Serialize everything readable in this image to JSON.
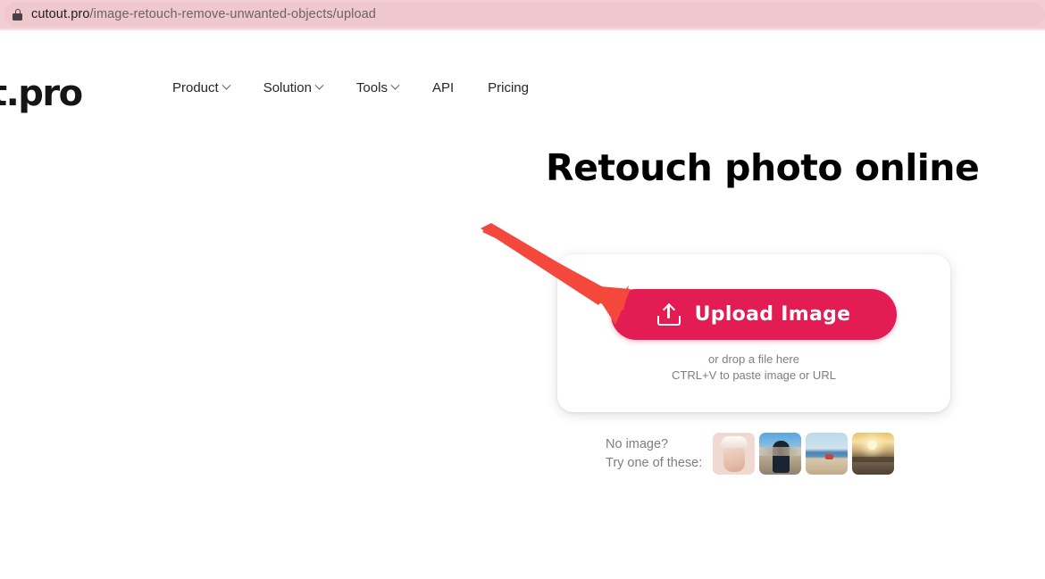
{
  "browser": {
    "lock_icon": "lock-icon",
    "url_host": "cutout.pro",
    "url_path": "/image-retouch-remove-unwanted-objects/upload",
    "urlbar_background": "#f2cdd2"
  },
  "header": {
    "logo_text": "ut.pro",
    "nav": [
      {
        "label": "Product",
        "has_dropdown": true
      },
      {
        "label": "Solution",
        "has_dropdown": true
      },
      {
        "label": "Tools",
        "has_dropdown": true
      },
      {
        "label": "API",
        "has_dropdown": false
      },
      {
        "label": "Pricing",
        "has_dropdown": false
      }
    ]
  },
  "main": {
    "title": "Retouch photo online",
    "upload": {
      "button_label": "Upload Image",
      "button_icon": "upload-icon",
      "button_color": "#e31c53",
      "hint_line_1": "or drop a file here",
      "hint_line_2": "CTRL+V to paste image or URL"
    },
    "samples": {
      "label_line_1": "No image?",
      "label_line_2": "Try one of these:",
      "thumbnails": [
        {
          "name": "sample-portrait",
          "alt": "woman portrait retouch sample"
        },
        {
          "name": "sample-street",
          "alt": "person on street sample"
        },
        {
          "name": "sample-beach",
          "alt": "beach scene sample"
        },
        {
          "name": "sample-sunset",
          "alt": "sunset over water sample"
        }
      ]
    }
  },
  "annotation": {
    "arrow_color": "#f4483c",
    "arrow_target": "upload-button"
  }
}
